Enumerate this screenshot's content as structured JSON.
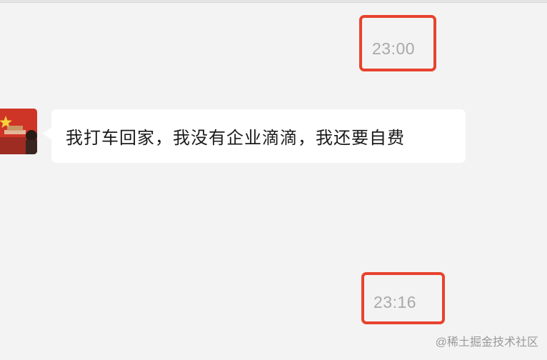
{
  "chat": {
    "timestamp_1": "23:00",
    "timestamp_2": "23:16",
    "messages": [
      {
        "direction": "incoming",
        "text": "我打车回家，我没有企业滴滴，我还要自费"
      }
    ]
  },
  "watermark": "@稀土掘金技术社区",
  "colors": {
    "background": "#f3f3f3",
    "bubble": "#ffffff",
    "highlight": "#e8432e",
    "timestamp": "#a9a9a9"
  },
  "icons": {
    "avatar": "flag-avatar"
  }
}
